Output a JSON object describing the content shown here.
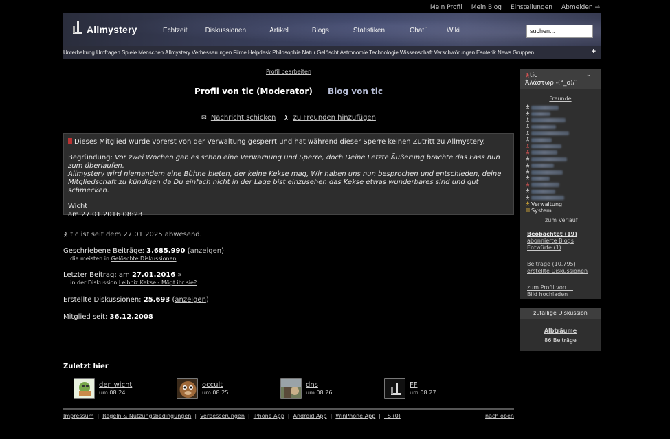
{
  "userbar": {
    "profile": "Mein Profil",
    "blog": "Mein Blog",
    "settings": "Einstellungen",
    "logout": "Abmelden →"
  },
  "header": {
    "logo": "Allmystery",
    "nav": [
      "Echtzeit",
      "Diskussionen",
      "Artikel",
      "Blogs",
      "Statistiken",
      "Chat",
      "Wiki"
    ],
    "chat_badge": "°",
    "search_placeholder": "suchen..."
  },
  "categories": [
    "Unterhaltung",
    "Umfragen",
    "Spiele",
    "Menschen",
    "Allmystery",
    "Verbesserungen",
    "Filme",
    "Helpdesk",
    "Philosophie",
    "Natur",
    "Gelöscht",
    "Astronomie",
    "Technologie",
    "Wissenschaft",
    "Verschwörungen",
    "Esoterik",
    "News",
    "Gruppen"
  ],
  "categories_more": "+",
  "profile": {
    "edit": "Profil bearbeiten",
    "title": "Profil von tic (Moderator)",
    "blog": "Blog von tic",
    "message": "Nachricht schicken",
    "message_icon": "✉",
    "add_friend": "zu Freunden hinzufügen",
    "add_friend_icon": "Ὣ6"
  },
  "notice": {
    "headline": "Dieses Mitglied wurde vorerst von der Verwaltung gesperrt und hat während dieser Sperre keinen Zutritt zu Allmystery.",
    "reason_label": "Begründung: ",
    "reason": "Vor zwei Wochen gab es schon eine Verwarnung und Sperre, doch Deine Letzte Äußerung brachte das Fass nun zum überlaufen.",
    "reason2": "Allmystery wird niemandem eine Bühne bieten, der keine Kekse mag, Wir haben uns nun besprochen und entschieden, deine Mitgliedschaft zu kündigen da Du einfach nicht in der Lage bist einzusehen das Kekse etwas wunderbares sind und gut schmecken.",
    "author": "Wicht",
    "date": "am 27.01.2016 08:23"
  },
  "stats": {
    "absent": "tic ist seit dem 27.01.2025 abwesend.",
    "posts_label": "Geschriebene Beiträge: ",
    "posts_value": "3.685.990",
    "posts_link": "anzeigen",
    "posts_sub_prefix": "... die meisten in ",
    "posts_sub_link": "Gelöschte Diskussionen",
    "last_label": "Letzter Beitrag: am ",
    "last_value": "27.01.2016",
    "last_link": "»",
    "last_sub_prefix": "... in der Diskussion ",
    "last_sub_link": "Leibniz Kekse - Mögt ihr sie?",
    "disc_label": "Erstellte Diskussionen: ",
    "disc_value": "25.693",
    "disc_link": "anzeigen",
    "member_label": "Mitglied seit: ",
    "member_value": "36.12.2008"
  },
  "recent": {
    "title": "Zuletzt hier",
    "visitors": [
      {
        "name": "der_wicht",
        "time": "um 08:24"
      },
      {
        "name": "occult",
        "time": "um 08:25"
      },
      {
        "name": "dns",
        "time": "um 08:26"
      },
      {
        "name": "FF",
        "time": "um 08:27"
      }
    ]
  },
  "footer": {
    "links": [
      "Impressum",
      "Regeln & Nutzungsbedingungen",
      "Verbesserungen",
      "iPhone App",
      "Android App",
      "WinPhone App",
      "TS (0)"
    ],
    "top": "nach oben"
  },
  "sidebar": {
    "user": "tic",
    "tagline": "Άλάστωρ -(°_o)/¯",
    "friends_title": "Freunde",
    "verwaltung": "Verwaltung",
    "system": "System",
    "history": "zum Verlauf",
    "watched": "Beobachtet (19)",
    "subscribed": "abonnierte Blogs",
    "drafts": "Entwürfe (1)",
    "posts": "Beiträge (10.795)",
    "created": "erstellte Diskussionen",
    "profile_of": "zum Profil von ...",
    "upload": "Bild hochladen",
    "random_title": "zufällige Diskussion",
    "random_link": "Albträume",
    "random_count": "86 Beiträge"
  },
  "colors": {
    "header_bg": "#3a4161",
    "catbar_bg": "#2b2d3a",
    "notice_bg": "#2d2d2d",
    "sidebar_bg": "#2f2f2f",
    "lock_red": "#b33"
  }
}
